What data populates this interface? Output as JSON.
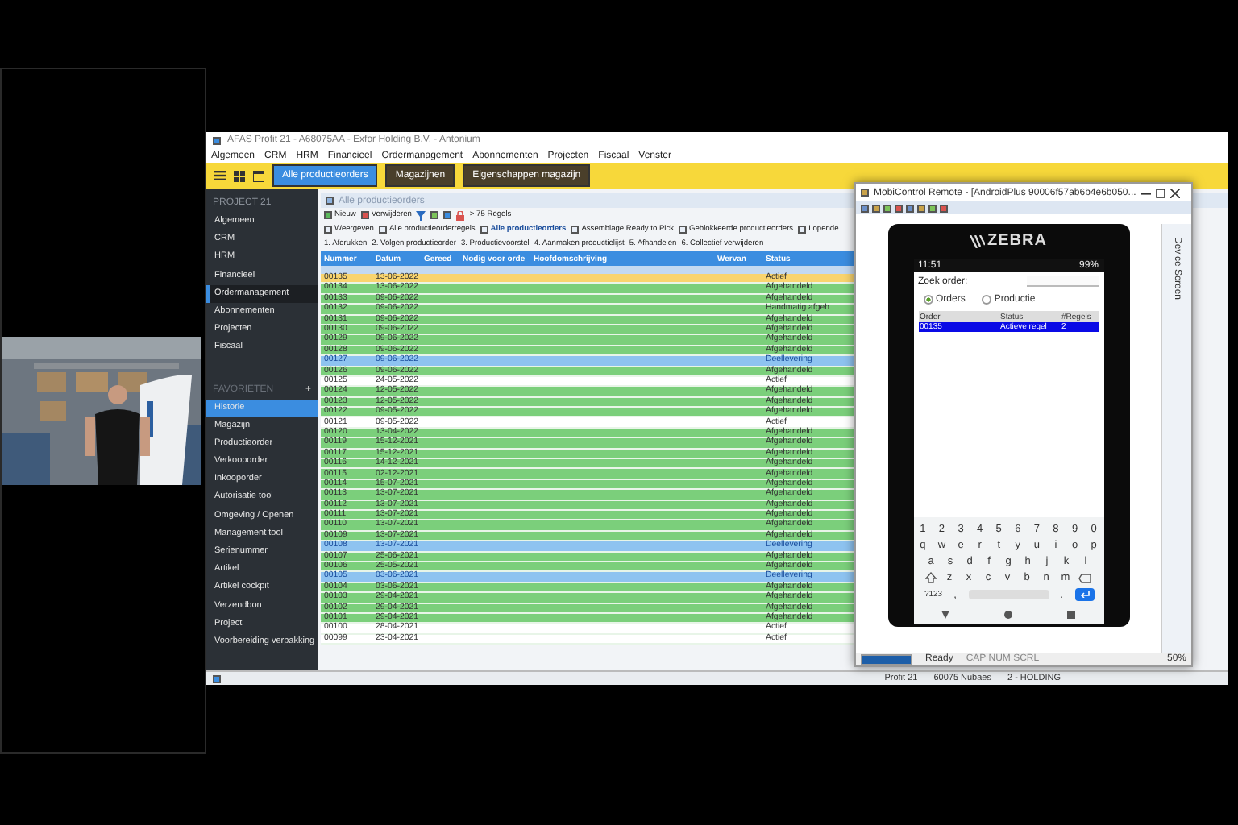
{
  "app": {
    "title": "AFAS Profit 21 - A68075AA - Exfor Holding B.V. - Antonium",
    "menu": [
      "Algemeen",
      "CRM",
      "HRM",
      "Financieel",
      "Ordermanagement",
      "Abonnementen",
      "Projecten",
      "Fiscaal",
      "Venster"
    ],
    "tabs": [
      {
        "label": "Alle productieorders",
        "selected": true
      },
      {
        "label": "Magazijnen",
        "selected": false
      },
      {
        "label": "Eigenschappen magazijn",
        "selected": false
      }
    ],
    "sidebar": {
      "header": "PROJECT 21",
      "items": [
        {
          "label": "Algemeen",
          "selected": false
        },
        {
          "label": "CRM",
          "selected": false
        },
        {
          "label": "HRM",
          "selected": false
        },
        {
          "label": "Financieel",
          "selected": false
        },
        {
          "label": "Ordermanagement",
          "selected": true
        },
        {
          "label": "Abonnementen",
          "selected": false
        },
        {
          "label": "Projecten",
          "selected": false
        },
        {
          "label": "Fiscaal",
          "selected": false
        }
      ],
      "favorites_header": "FAVORIETEN",
      "favorites_add": "+",
      "favorites": [
        {
          "label": "Historie",
          "selected": true
        },
        {
          "label": "Magazijn",
          "selected": false
        },
        {
          "label": "Productieorder",
          "selected": false
        },
        {
          "label": "Verkooporder",
          "selected": false
        },
        {
          "label": "Inkooporder",
          "selected": false
        },
        {
          "label": "Autorisatie tool",
          "selected": false
        },
        {
          "label": "Omgeving / Openen",
          "selected": false
        },
        {
          "label": "Management tool",
          "selected": false
        },
        {
          "label": "Serienummer",
          "selected": false
        },
        {
          "label": "Artikel",
          "selected": false
        },
        {
          "label": "Artikel cockpit",
          "selected": false
        },
        {
          "label": "Verzendbon",
          "selected": false
        },
        {
          "label": "Project",
          "selected": false
        },
        {
          "label": "Voorbereiding verpakking",
          "selected": false
        }
      ]
    },
    "panel_title": "Alle productieorders",
    "toolbar": {
      "new": "Nieuw",
      "delete": "Verwijderen",
      "count": "> 75 Regels"
    },
    "views": [
      {
        "label": "Weergeven",
        "selected": false
      },
      {
        "label": "Alle productieorderregels",
        "selected": false
      },
      {
        "label": "Alle productieorders",
        "selected": true
      },
      {
        "label": "Assemblage Ready to Pick",
        "selected": false
      },
      {
        "label": "Geblokkeerde productieorders",
        "selected": false
      },
      {
        "label": "Lopende",
        "selected": false
      }
    ],
    "actions": [
      "1. Afdrukken",
      "2. Volgen productieorder",
      "3. Productievoorstel",
      "4. Aanmaken productielijst",
      "5. Afhandelen",
      "6. Collectief verwijderen"
    ],
    "table": {
      "columns": [
        "Nummer",
        "Datum",
        "Gereed",
        "Nodig voor orde",
        "Hoofdomschrijving",
        "Wervan",
        "Status"
      ],
      "rows": [
        {
          "number": "00135",
          "date": "13-06-2022",
          "status": "Actief",
          "kind": "active",
          "selected": true
        },
        {
          "number": "00134",
          "date": "13-06-2022",
          "status": "Afgehandeld",
          "kind": "done",
          "selected": false
        },
        {
          "number": "00133",
          "date": "09-06-2022",
          "status": "Afgehandeld",
          "kind": "done",
          "selected": false
        },
        {
          "number": "00132",
          "date": "09-06-2022",
          "status": "Handmatig afgeh",
          "kind": "done",
          "selected": false
        },
        {
          "number": "00131",
          "date": "09-06-2022",
          "status": "Afgehandeld",
          "kind": "done",
          "selected": false
        },
        {
          "number": "00130",
          "date": "09-06-2022",
          "status": "Afgehandeld",
          "kind": "done",
          "selected": false
        },
        {
          "number": "00129",
          "date": "09-06-2022",
          "status": "Afgehandeld",
          "kind": "done",
          "selected": false
        },
        {
          "number": "00128",
          "date": "09-06-2022",
          "status": "Afgehandeld",
          "kind": "done",
          "selected": false
        },
        {
          "number": "00127",
          "date": "09-06-2022",
          "status": "Deellevering",
          "kind": "partial",
          "selected": false
        },
        {
          "number": "00126",
          "date": "09-06-2022",
          "status": "Afgehandeld",
          "kind": "done",
          "selected": false
        },
        {
          "number": "00125",
          "date": "24-05-2022",
          "status": "Actief",
          "kind": "active",
          "selected": false
        },
        {
          "number": "00124",
          "date": "12-05-2022",
          "status": "Afgehandeld",
          "kind": "done",
          "selected": false
        },
        {
          "number": "00123",
          "date": "12-05-2022",
          "status": "Afgehandeld",
          "kind": "done",
          "selected": false
        },
        {
          "number": "00122",
          "date": "09-05-2022",
          "status": "Afgehandeld",
          "kind": "done",
          "selected": false
        },
        {
          "number": "00121",
          "date": "09-05-2022",
          "status": "Actief",
          "kind": "active",
          "selected": false
        },
        {
          "number": "00120",
          "date": "13-04-2022",
          "status": "Afgehandeld",
          "kind": "done",
          "selected": false
        },
        {
          "number": "00119",
          "date": "15-12-2021",
          "status": "Afgehandeld",
          "kind": "done",
          "selected": false
        },
        {
          "number": "00117",
          "date": "15-12-2021",
          "status": "Afgehandeld",
          "kind": "done",
          "selected": false
        },
        {
          "number": "00116",
          "date": "14-12-2021",
          "status": "Afgehandeld",
          "kind": "done",
          "selected": false
        },
        {
          "number": "00115",
          "date": "02-12-2021",
          "status": "Afgehandeld",
          "kind": "done",
          "selected": false
        },
        {
          "number": "00114",
          "date": "15-07-2021",
          "status": "Afgehandeld",
          "kind": "done",
          "selected": false
        },
        {
          "number": "00113",
          "date": "13-07-2021",
          "status": "Afgehandeld",
          "kind": "done",
          "selected": false
        },
        {
          "number": "00112",
          "date": "13-07-2021",
          "status": "Afgehandeld",
          "kind": "done",
          "selected": false
        },
        {
          "number": "00111",
          "date": "13-07-2021",
          "status": "Afgehandeld",
          "kind": "done",
          "selected": false
        },
        {
          "number": "00110",
          "date": "13-07-2021",
          "status": "Afgehandeld",
          "kind": "done",
          "selected": false
        },
        {
          "number": "00109",
          "date": "13-07-2021",
          "status": "Afgehandeld",
          "kind": "done",
          "selected": false
        },
        {
          "number": "00108",
          "date": "13-07-2021",
          "status": "Deellevering",
          "kind": "partial",
          "selected": false
        },
        {
          "number": "00107",
          "date": "25-06-2021",
          "status": "Afgehandeld",
          "kind": "done",
          "selected": false
        },
        {
          "number": "00106",
          "date": "25-05-2021",
          "status": "Afgehandeld",
          "kind": "done",
          "selected": false
        },
        {
          "number": "00105",
          "date": "03-06-2021",
          "status": "Deellevering",
          "kind": "partial",
          "selected": false
        },
        {
          "number": "00104",
          "date": "03-06-2021",
          "status": "Afgehandeld",
          "kind": "done",
          "selected": false
        },
        {
          "number": "00103",
          "date": "29-04-2021",
          "status": "Afgehandeld",
          "kind": "done",
          "selected": false
        },
        {
          "number": "00102",
          "date": "29-04-2021",
          "status": "Afgehandeld",
          "kind": "done",
          "selected": false
        },
        {
          "number": "00101",
          "date": "29-04-2021",
          "status": "Afgehandeld",
          "kind": "done",
          "selected": false
        },
        {
          "number": "00100",
          "date": "28-04-2021",
          "status": "Actief",
          "kind": "active",
          "selected": false
        },
        {
          "number": "00099",
          "date": "23-04-2021",
          "status": "Actief",
          "kind": "active",
          "selected": false
        }
      ]
    },
    "status_bar": [
      "Profit 21",
      "60075 Nubaes",
      "2 - HOLDING"
    ]
  },
  "remote": {
    "title": "MobiControl Remote - [AndroidPlus 90006f57ab6b4e6b050...",
    "side_tab": "Device Screen",
    "progress": {
      "level": 1
    },
    "status": "Ready",
    "locks": "CAP  NUM  SCRL",
    "zoom": "50%",
    "phone": {
      "brand": "ZEBRA",
      "time": "11:51",
      "battery": "99%",
      "search_label": "Zoek order:",
      "modes": [
        {
          "label": "Orders",
          "selected": true
        },
        {
          "label": "Productie",
          "selected": false
        }
      ],
      "columns": [
        "Order",
        "Status",
        "#Regels"
      ],
      "rows": [
        {
          "cells": [
            "00135",
            "Actieve regel",
            "2"
          ],
          "selected": true
        }
      ],
      "keyboard": [
        [
          "1",
          "2",
          "3",
          "4",
          "5",
          "6",
          "7",
          "8",
          "9",
          "0"
        ],
        [
          "q",
          "w",
          "e",
          "r",
          "t",
          "y",
          "u",
          "i",
          "o",
          "p"
        ],
        [
          "a",
          "s",
          "d",
          "f",
          "g",
          "h",
          "j",
          "k",
          "l"
        ],
        [
          "z",
          "x",
          "c",
          "v",
          "b",
          "n",
          "m"
        ]
      ],
      "symbols_key": "?123",
      "comma_key": ",",
      "period_key": "."
    }
  }
}
